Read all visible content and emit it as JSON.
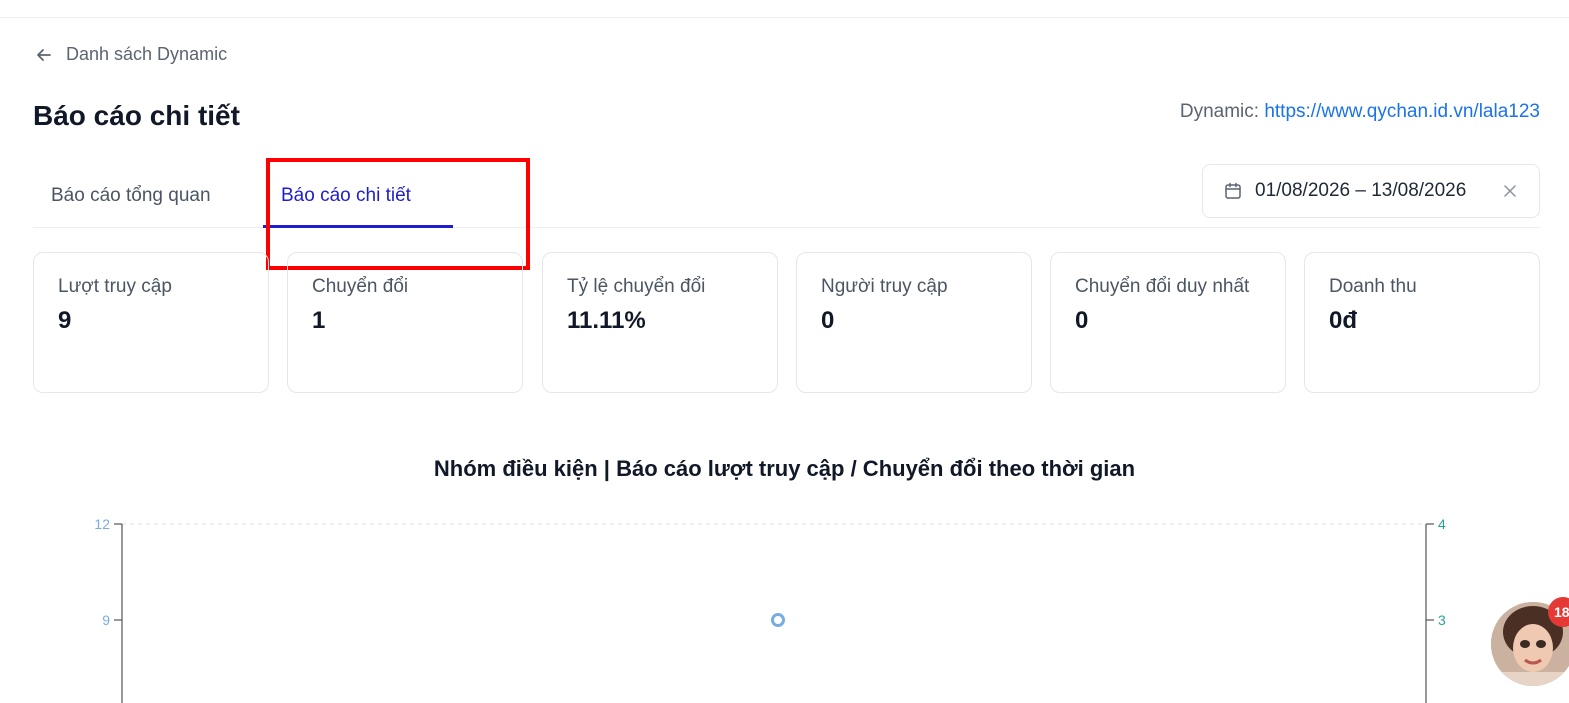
{
  "nav": {
    "back_label": "Danh sách Dynamic"
  },
  "header": {
    "title": "Báo cáo chi tiết",
    "dynamic_prefix": "Dynamic: ",
    "dynamic_url": "https://www.qychan.id.vn/lala123"
  },
  "tabs": [
    {
      "label": "Báo cáo tổng quan",
      "active": false
    },
    {
      "label": "Báo cáo chi tiết",
      "active": true
    }
  ],
  "date_range": {
    "value": "01/08/2026 – 13/08/2026",
    "icon": "calendar-icon"
  },
  "stats": [
    {
      "label": "Lượt truy cập",
      "value": "9"
    },
    {
      "label": "Chuyển đổi",
      "value": "1"
    },
    {
      "label": "Tỷ lệ chuyển đổi",
      "value": "11.11%"
    },
    {
      "label": "Người truy cập",
      "value": "0"
    },
    {
      "label": "Chuyển đổi duy nhất",
      "value": "0"
    },
    {
      "label": "Doanh thu",
      "value": "0đ"
    }
  ],
  "chart_title": "Nhóm điều kiện | Báo cáo lượt truy cập / Chuyển đổi theo thời gian",
  "chart_data": {
    "type": "line",
    "title": "Nhóm điều kiện | Báo cáo lượt truy cập / Chuyển đổi theo thời gian",
    "left_axis": {
      "ticks": [
        "12",
        "9"
      ],
      "color": "#7aaddf"
    },
    "right_axis": {
      "ticks": [
        "4",
        "3"
      ],
      "color": "#2aa198"
    },
    "series": [
      {
        "axis": "left",
        "color": "#7aaddf",
        "values": [
          9
        ]
      }
    ]
  },
  "notification": {
    "count": "18"
  },
  "colors": {
    "accent": "#1e1ecf",
    "link": "#1a73e8",
    "highlight": "#ff0000"
  }
}
